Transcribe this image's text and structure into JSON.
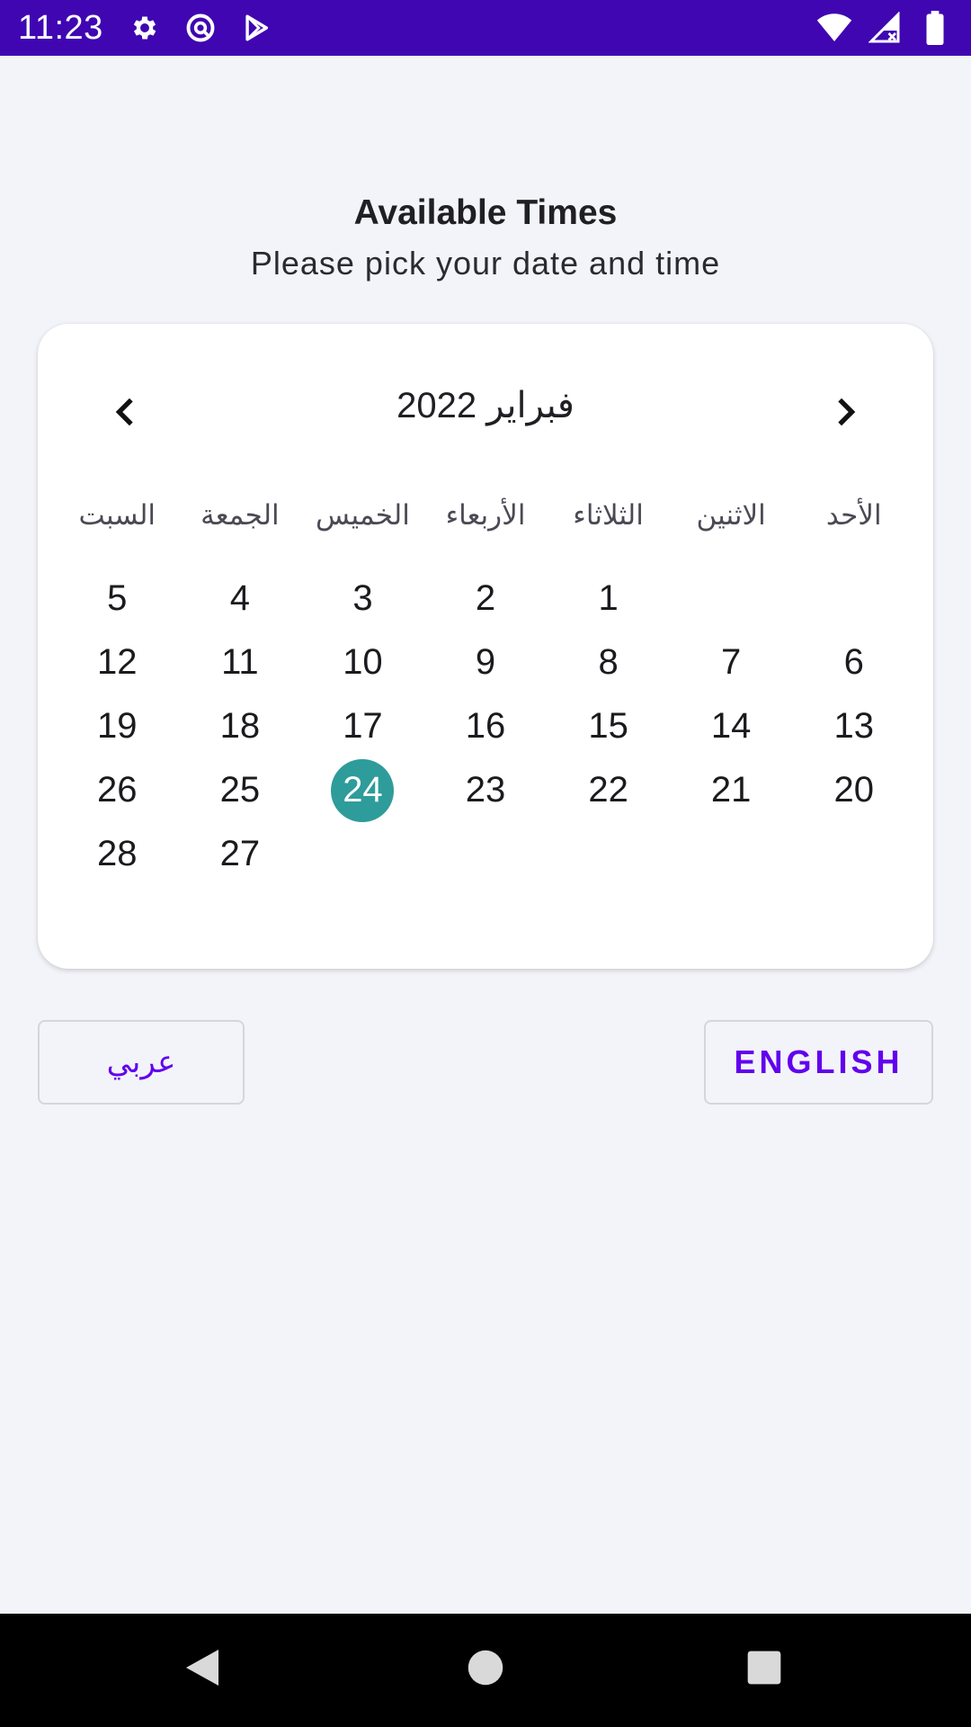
{
  "status_bar": {
    "time": "11:23",
    "left_icons": [
      "settings-icon",
      "at-sign-icon",
      "play-store-icon"
    ],
    "right_icons": [
      "wifi-icon",
      "cellular-signal-icon",
      "battery-icon"
    ],
    "background": "#3f06b2"
  },
  "header": {
    "title": "Available Times",
    "subtitle": "Please pick your date and time"
  },
  "calendar": {
    "month_label": "فبراير 2022",
    "prev_icon": "chevron-left-icon",
    "next_icon": "chevron-right-icon",
    "weekdays": [
      "الأحد",
      "الاثنين",
      "الثلاثاء",
      "الأربعاء",
      "الخميس",
      "الجمعة",
      "السبت"
    ],
    "weeks": [
      [
        "",
        "",
        "1",
        "2",
        "3",
        "4",
        "5"
      ],
      [
        "6",
        "7",
        "8",
        "9",
        "10",
        "11",
        "12"
      ],
      [
        "13",
        "14",
        "15",
        "16",
        "17",
        "18",
        "19"
      ],
      [
        "20",
        "21",
        "22",
        "23",
        "24",
        "25",
        "26"
      ],
      [
        "",
        "",
        "",
        "",
        "",
        "27",
        "28"
      ]
    ],
    "selected_day": "24",
    "selected_color": "#2e9c9a"
  },
  "language_buttons": {
    "arabic_label": "عربي",
    "english_label": "ENGLISH",
    "accent_color": "#6200ee"
  },
  "nav_bar": {
    "icons": [
      "back-icon",
      "home-icon",
      "recents-icon"
    ]
  }
}
